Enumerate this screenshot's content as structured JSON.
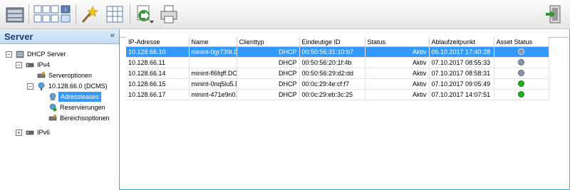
{
  "left_panel": {
    "title": "Server",
    "collapse_glyph": "«",
    "tree": [
      {
        "label": "DHCP Server",
        "icon": "server-icon",
        "expander": "−"
      },
      {
        "label": "IPv4",
        "icon": "network-icon",
        "expander": "−"
      },
      {
        "label": "Serveroptionen",
        "icon": "options-icon",
        "expander": ""
      },
      {
        "label": "10.128.66.0 (DCMS)",
        "icon": "scope-icon",
        "expander": "−"
      },
      {
        "label": "Adressleases",
        "icon": "leases-icon",
        "expander": ""
      },
      {
        "label": "Reservierungen",
        "icon": "reservations-icon",
        "expander": ""
      },
      {
        "label": "Bereichsoptionen",
        "icon": "scope-options-icon",
        "expander": ""
      },
      {
        "label": "IPv6",
        "icon": "network-icon",
        "expander": "+"
      }
    ]
  },
  "grid": {
    "headers": [
      "IP-Adresse",
      "Name",
      "Clienttyp",
      "Eindeutige ID",
      "Status",
      "Ablaufzeitpunkt",
      "Asset Status"
    ],
    "rows": [
      {
        "ip": "10.128.66.10",
        "name": "minint-0gr739t.D",
        "type": "DHCP",
        "uid": "00:50:56:31:10:b7",
        "status": "Aktiv",
        "expiry": "06.10.2017 17:40:28",
        "asset": "grey"
      },
      {
        "ip": "10.128.66.11",
        "name": "",
        "type": "DHCP",
        "uid": "00:50:56:20:1f:4b",
        "status": "Aktiv",
        "expiry": "07.10.2017 08:55:33",
        "asset": "grey"
      },
      {
        "ip": "10.128.66.14",
        "name": "minint-fl6fqff.DCl",
        "type": "DHCP",
        "uid": "00:50:56:29:d2:dd",
        "status": "Aktiv",
        "expiry": "07.10.2017 08:58:31",
        "asset": "grey"
      },
      {
        "ip": "10.128.66.15",
        "name": "minint-0nq5iu5.D",
        "type": "DHCP",
        "uid": "00:0c:29:4e:cf:f7",
        "status": "Aktiv",
        "expiry": "07.10.2017 09:05:49",
        "asset": "green"
      },
      {
        "ip": "10.128.66.17",
        "name": "minint-471e9n0.",
        "type": "DHCP",
        "uid": "00:0c:29:eb:3c:25",
        "status": "Aktiv",
        "expiry": "07.10.2017 14:07:51",
        "asset": "green"
      }
    ]
  },
  "toolbar_icons": [
    "server-icon",
    "view-tiles-icon",
    "wand-icon",
    "grid-view-icon",
    "import-icon",
    "printer-icon",
    "exit-icon"
  ],
  "colors": {
    "selection": "#3399ff",
    "green": "#22b022",
    "grey": "#8a96a6",
    "accent_border": "#2ab5e8"
  }
}
